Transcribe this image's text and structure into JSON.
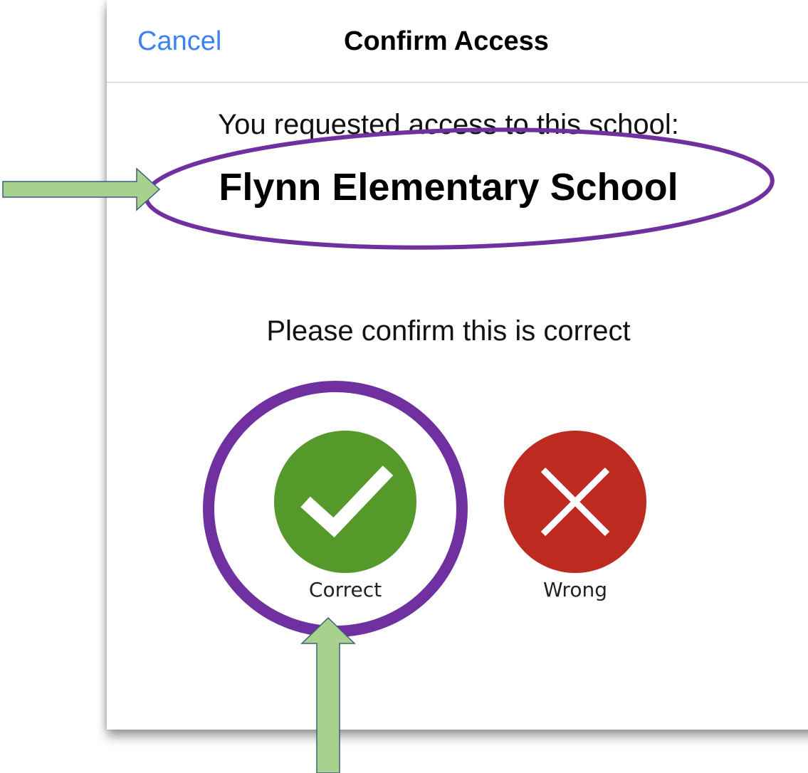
{
  "navbar": {
    "cancel_label": "Cancel",
    "title": "Confirm Access"
  },
  "content": {
    "request_text": "You requested access to this school:",
    "school_name": "Flynn Elementary School",
    "confirm_text": "Please confirm this is correct"
  },
  "choices": {
    "correct": {
      "label": "Correct",
      "icon": "checkmark-icon",
      "color": "#55992b"
    },
    "wrong": {
      "label": "Wrong",
      "icon": "x-icon",
      "color": "#bd2a1f"
    }
  },
  "annotations": {
    "ellipse_color": "#7030a0",
    "arrow_fill": "#a9d18e",
    "arrow_stroke": "#3b5f7f"
  },
  "colors": {
    "link": "#3b82f6"
  }
}
